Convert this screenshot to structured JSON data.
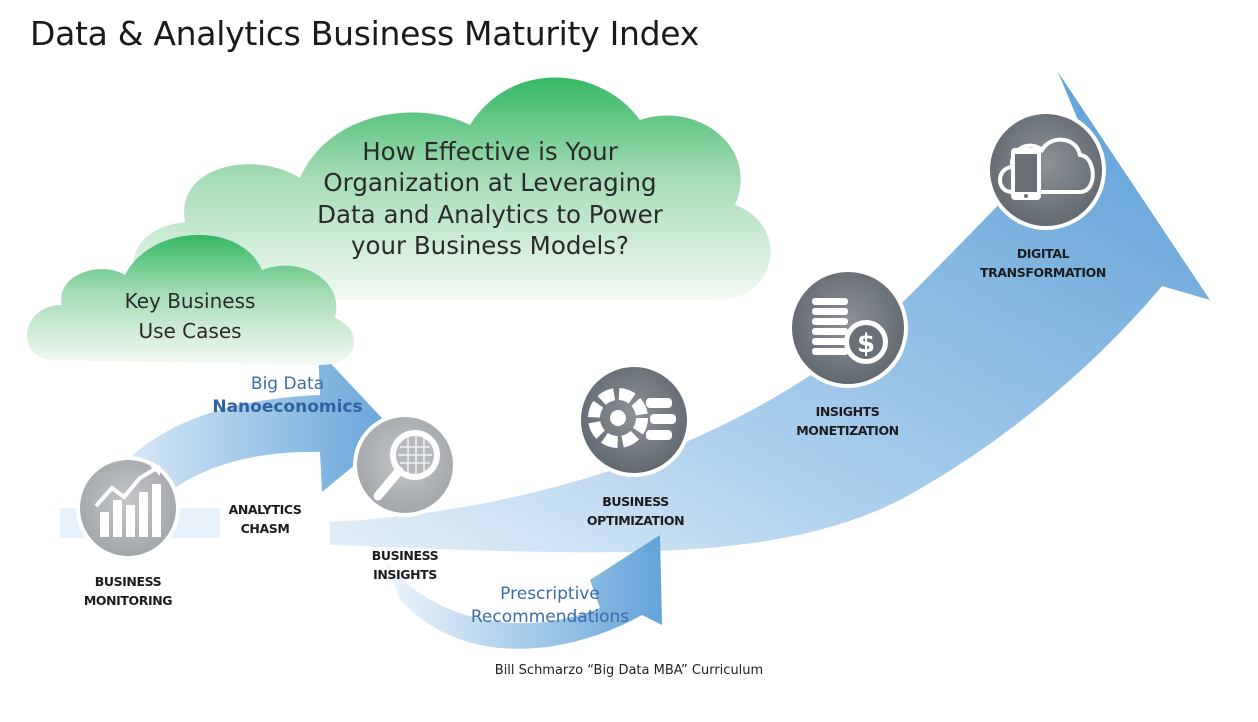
{
  "title": "Data & Analytics Business Maturity Index",
  "clouds": {
    "main": [
      "How Effective is Your",
      "Organization at Leveraging",
      "Data and Analytics to Power",
      "your Business Models?"
    ],
    "secondary": [
      "Key Business",
      "Use Cases"
    ]
  },
  "flow_labels": {
    "upper": [
      "Big Data",
      "Nanoeconomics"
    ],
    "lower": [
      "Prescriptive",
      "Recommendations"
    ]
  },
  "stages": [
    {
      "lines": [
        "BUSINESS",
        "MONITORING"
      ],
      "icon": "chart-trend-icon"
    },
    {
      "lines": [
        "BUSINESS",
        "INSIGHTS"
      ],
      "icon": "magnifier-icon"
    },
    {
      "lines": [
        "BUSINESS",
        "OPTIMIZATION"
      ],
      "icon": "gears-icon"
    },
    {
      "lines": [
        "INSIGHTS",
        "MONETIZATION"
      ],
      "icon": "coins-dollar-icon"
    },
    {
      "lines": [
        "DIGITAL",
        "TRANSFORMATION"
      ],
      "icon": "cloud-tablet-icon"
    }
  ],
  "chasm_label": [
    "ANALYTICS",
    "CHASM"
  ],
  "footer": "Bill Schmarzo “Big Data MBA” Curriculum",
  "colors": {
    "arrow_dark": "#5a9fd6",
    "arrow_light": "#cfe4f5",
    "cloud_top": "#3dbd6a",
    "cloud_bottom": "#f3faf4",
    "icon_circle": "#6f757c",
    "flow_text": "#3a6da8"
  }
}
